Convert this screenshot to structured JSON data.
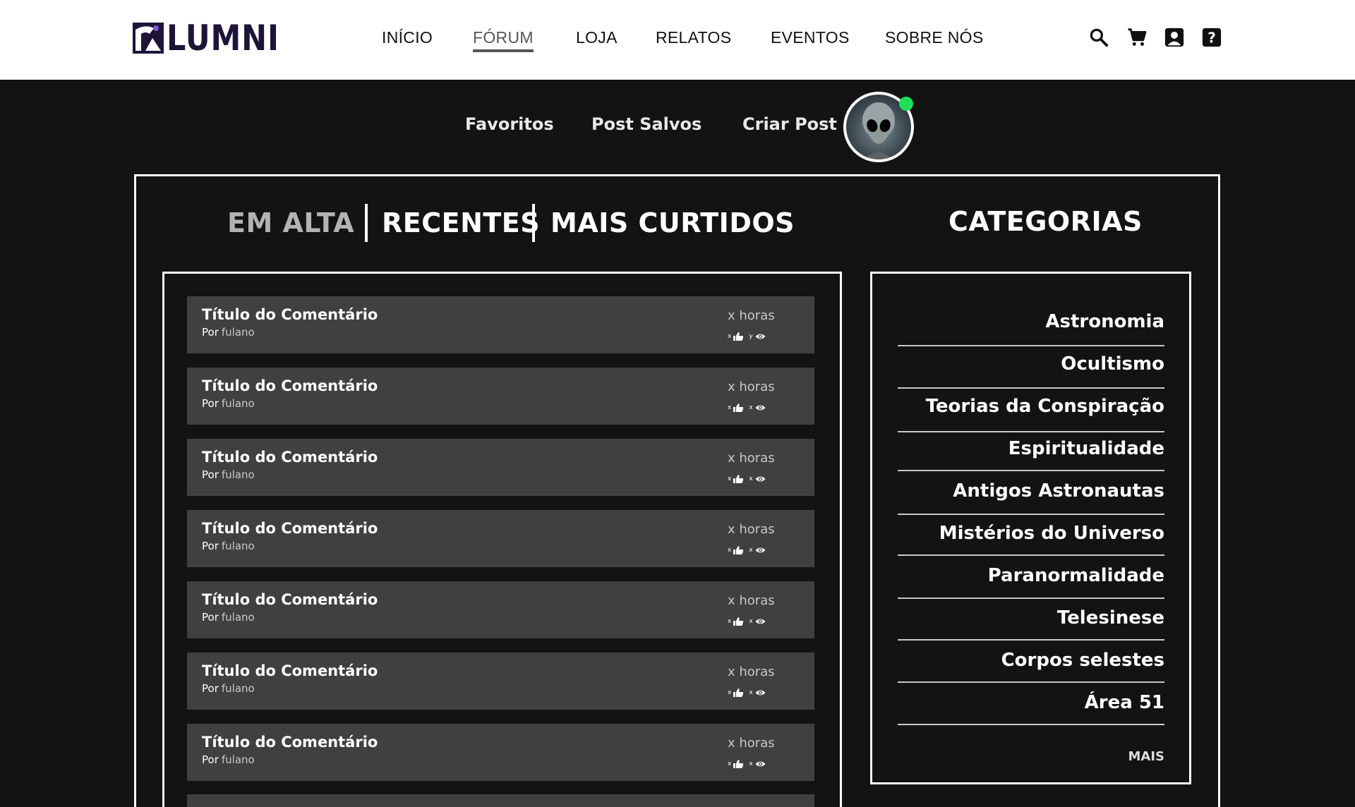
{
  "brand": {
    "logo_text": "LUMNI"
  },
  "nav": {
    "items": [
      {
        "label": "INÍCIO"
      },
      {
        "label": "FÓRUM",
        "active": true
      },
      {
        "label": "LOJA"
      },
      {
        "label": "RELATOS"
      },
      {
        "label": "EVENTOS"
      },
      {
        "label": "SOBRE NÓS"
      }
    ],
    "icons": [
      "search-icon",
      "cart-icon",
      "profile-icon",
      "help-icon"
    ]
  },
  "subnav": {
    "items": [
      {
        "label": "Favoritos"
      },
      {
        "label": "Post Salvos"
      },
      {
        "label": "Criar Post"
      }
    ],
    "avatar_status": "online"
  },
  "tabs": [
    {
      "label": "EM ALTA",
      "active": true
    },
    {
      "label": "RECENTES"
    },
    {
      "label": "MAIS CURTIDOS"
    }
  ],
  "posts": [
    {
      "title": "Título do Comentário",
      "by_label": "Por",
      "author": "fulano",
      "time": "x horas",
      "likes": "x",
      "views": "y"
    },
    {
      "title": "Título do Comentário",
      "by_label": "Por",
      "author": "fulano",
      "time": "x horas",
      "likes": "x",
      "views": "x"
    },
    {
      "title": "Título do Comentário",
      "by_label": "Por",
      "author": "fulano",
      "time": "x horas",
      "likes": "x",
      "views": "x"
    },
    {
      "title": "Título do Comentário",
      "by_label": "Por",
      "author": "fulano",
      "time": "x horas",
      "likes": "x",
      "views": "x"
    },
    {
      "title": "Título do Comentário",
      "by_label": "Por",
      "author": "fulano",
      "time": "x horas",
      "likes": "x",
      "views": "x"
    },
    {
      "title": "Título do Comentário",
      "by_label": "Por",
      "author": "fulano",
      "time": "x horas",
      "likes": "x",
      "views": "x"
    },
    {
      "title": "Título do Comentário",
      "by_label": "Por",
      "author": "fulano",
      "time": "x horas",
      "likes": "x",
      "views": "x"
    }
  ],
  "categories": {
    "title": "CATEGORIAS",
    "items": [
      "Astronomia",
      "Ocultismo",
      "Teorias da Conspiração",
      "Espiritualidade",
      "Antigos Astronautas",
      "Mistérios do Universo",
      "Paranormalidade",
      "Telesinese",
      "Corpos selestes",
      "Área 51"
    ],
    "more_label": "MAIS"
  },
  "colors": {
    "background": "#131313",
    "topbar": "#ffffff",
    "post_card": "#404040",
    "logo": "#1e1438",
    "online": "#1fe05a"
  }
}
